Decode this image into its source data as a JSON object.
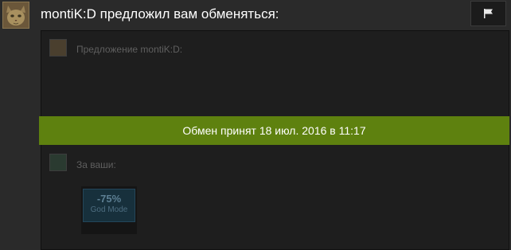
{
  "header": {
    "title": "montiK:D предложил вам обменяться:",
    "avatar_icon": "cat-avatar-icon",
    "report_icon": "flag-icon"
  },
  "offer": {
    "them_label": "Предложение montiK:D:",
    "you_label": "За ваши:",
    "status_banner": "Обмен принят 18 июл. 2016 в 11:17",
    "banner_color": "#5e810f",
    "items": [
      {
        "discount": "-75%",
        "name": "God Mode"
      }
    ]
  }
}
